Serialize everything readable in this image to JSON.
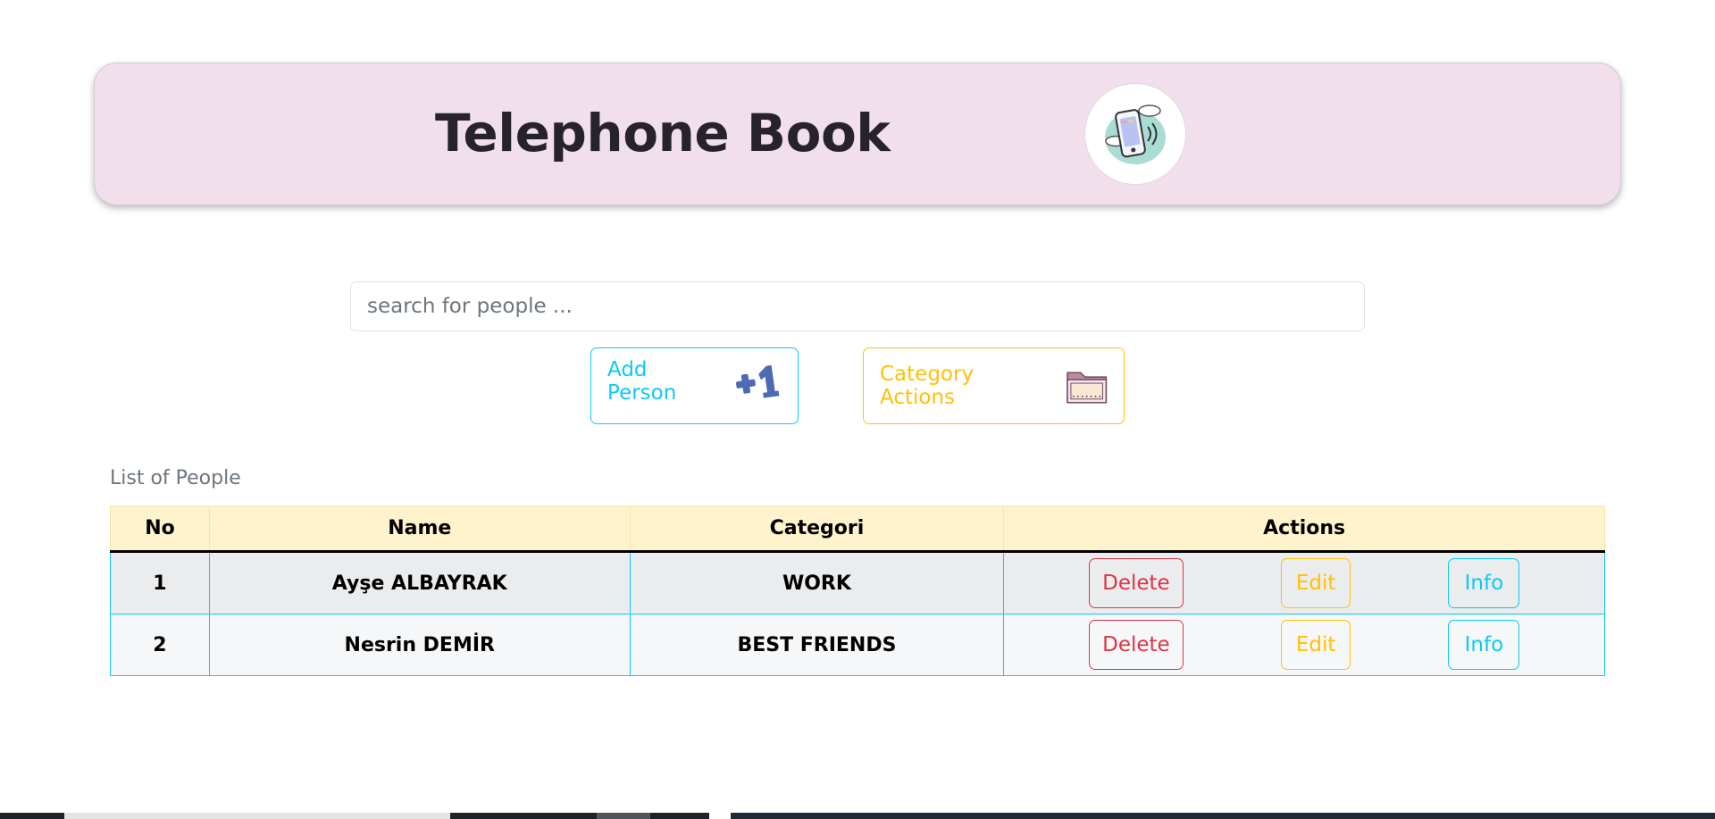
{
  "header": {
    "title": "Telephone Book",
    "logo_icon": "phone-calling-icon"
  },
  "search": {
    "placeholder": "search for people ..."
  },
  "toolbar": {
    "add_person_label": "Add Person",
    "add_person_icon": "plus-one-icon",
    "category_actions_label": "Category Actions",
    "category_actions_icon": "folder-icon"
  },
  "list": {
    "caption": "List of People",
    "columns": [
      "No",
      "Name",
      "Categori",
      "Actions"
    ],
    "rows": [
      {
        "no": "1",
        "name": "Ayşe ALBAYRAK",
        "category": "WORK"
      },
      {
        "no": "2",
        "name": "Nesrin DEMİR",
        "category": "BEST FRIENDS"
      }
    ],
    "action_labels": {
      "delete": "Delete",
      "edit": "Edit",
      "info": "Info"
    }
  },
  "colors": {
    "header_bg": "#f1e0ec",
    "table_header_bg": "#fff3cd",
    "info": "#0dcaf0",
    "warning": "#ffc107",
    "danger": "#dc3545"
  }
}
